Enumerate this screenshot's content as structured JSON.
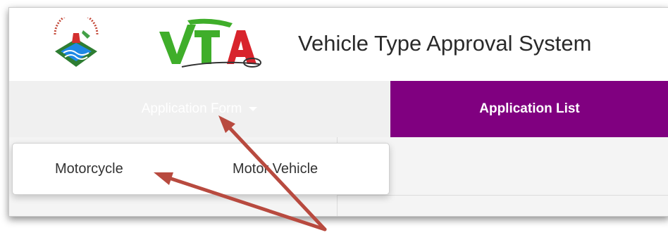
{
  "header": {
    "title": "Vehicle Type Approval System",
    "logo_text": "VTA"
  },
  "nav": {
    "application_form": "Application Form",
    "application_list": "Application List"
  },
  "dropdown": {
    "items": [
      "Motorcycle",
      "Motor Vehicle"
    ]
  },
  "colors": {
    "nav_active": "#800080",
    "annotation_arrow": "#b84a3f",
    "logo_green": "#3fae2a",
    "logo_red": "#d8242c"
  },
  "icons": [
    "agency-logo-icon",
    "vta-logo-icon",
    "caret-down-icon"
  ]
}
